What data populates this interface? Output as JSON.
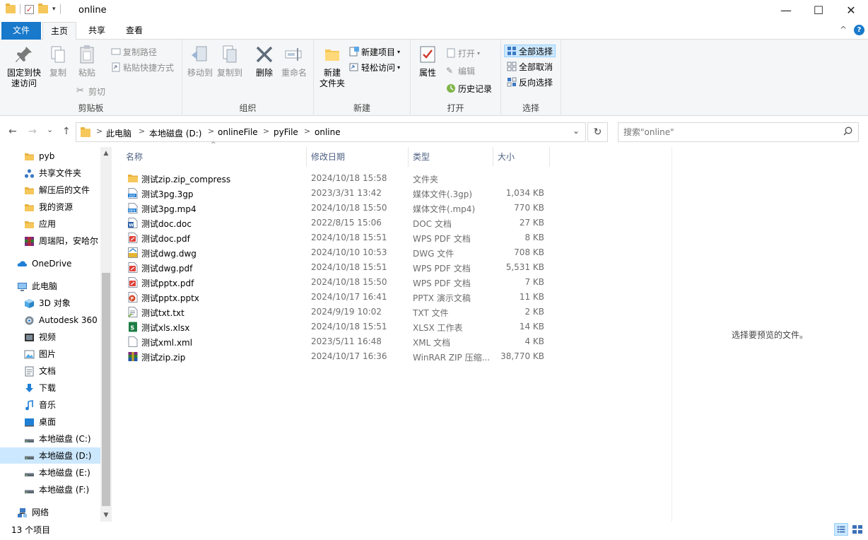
{
  "window": {
    "title": "online",
    "minimize_glyph": "—",
    "maximize_glyph": "☐",
    "close_glyph": "✕"
  },
  "ribbon_tabs": {
    "file": "文件",
    "home": "主页",
    "share": "共享",
    "view": "查看",
    "collapse_glyph": "^",
    "help_glyph": "?"
  },
  "ribbon": {
    "clipboard": {
      "label": "剪贴板",
      "pin": "固定到快\n速访问",
      "copy": "复制",
      "paste": "粘贴",
      "copy_path": "复制路径",
      "paste_shortcut": "粘贴快捷方式",
      "cut": "剪切"
    },
    "organize": {
      "label": "组织",
      "move_to": "移动到",
      "copy_to": "复制到",
      "delete": "删除",
      "rename": "重命名"
    },
    "new": {
      "label": "新建",
      "new_folder": "新建\n文件夹",
      "new_item": "新建项目",
      "easy_access": "轻松访问"
    },
    "open": {
      "label": "打开",
      "properties": "属性",
      "open": "打开",
      "edit": "编辑",
      "history": "历史记录"
    },
    "select": {
      "label": "选择",
      "select_all": "全部选择",
      "select_none": "全部取消",
      "invert": "反向选择"
    }
  },
  "address": {
    "crumbs": [
      "此电脑",
      "本地磁盘 (D:)",
      "onlineFile",
      "pyFile",
      "online"
    ],
    "separator": ">",
    "dropdown_glyph": "⌄",
    "refresh_glyph": "↻"
  },
  "search": {
    "placeholder": "搜索\"online\"",
    "icon": "search-icon"
  },
  "nav": {
    "back_glyph": "←",
    "forward_glyph": "→",
    "recent_glyph": "⌄",
    "up_glyph": "↑",
    "items": [
      {
        "label": "pyb",
        "icon": "folder-icon"
      },
      {
        "label": "共享文件夹",
        "icon": "share-icon"
      },
      {
        "label": "解压后的文件",
        "icon": "folder-icon"
      },
      {
        "label": "我的资源",
        "icon": "folder-icon"
      },
      {
        "label": "应用",
        "icon": "folder-icon"
      },
      {
        "label": "周瑞阳，安哈尔",
        "icon": "rar-icon"
      },
      {
        "label": "OneDrive",
        "icon": "cloud-icon"
      },
      {
        "label": "此电脑",
        "icon": "computer-icon"
      },
      {
        "label": "3D 对象",
        "icon": "cube-icon"
      },
      {
        "label": "Autodesk 360",
        "icon": "autodesk-icon"
      },
      {
        "label": "视频",
        "icon": "video-icon"
      },
      {
        "label": "图片",
        "icon": "picture-icon"
      },
      {
        "label": "文档",
        "icon": "document-icon"
      },
      {
        "label": "下载",
        "icon": "download-icon"
      },
      {
        "label": "音乐",
        "icon": "music-icon"
      },
      {
        "label": "桌面",
        "icon": "desktop-icon"
      },
      {
        "label": "本地磁盘 (C:)",
        "icon": "drive-icon"
      },
      {
        "label": "本地磁盘 (D:)",
        "icon": "drive-icon",
        "selected": true
      },
      {
        "label": "本地磁盘 (E:)",
        "icon": "drive-icon"
      },
      {
        "label": "本地磁盘 (F:)",
        "icon": "drive-icon"
      },
      {
        "label": "网络",
        "icon": "network-icon"
      }
    ]
  },
  "columns": {
    "name": "名称",
    "modified": "修改日期",
    "type": "类型",
    "size": "大小"
  },
  "files": [
    {
      "name": "测试zip.zip_compress",
      "modified": "2024/10/18 15:58",
      "type": "文件夹",
      "size": "",
      "icon": "folder-icon"
    },
    {
      "name": "测试3pg.3gp",
      "modified": "2023/3/31 13:42",
      "type": "媒体文件(.3gp)",
      "size": "1,034 KB",
      "icon": "3gp-icon"
    },
    {
      "name": "测试3pg.mp4",
      "modified": "2024/10/18 15:50",
      "type": "媒体文件(.mp4)",
      "size": "770 KB",
      "icon": "mp4-icon"
    },
    {
      "name": "测试doc.doc",
      "modified": "2022/8/15 15:06",
      "type": "DOC 文档",
      "size": "27 KB",
      "icon": "doc-icon"
    },
    {
      "name": "测试doc.pdf",
      "modified": "2024/10/18 15:51",
      "type": "WPS PDF 文档",
      "size": "8 KB",
      "icon": "pdf-icon"
    },
    {
      "name": "测试dwg.dwg",
      "modified": "2024/10/10 10:53",
      "type": "DWG 文件",
      "size": "708 KB",
      "icon": "dwg-icon"
    },
    {
      "name": "测试dwg.pdf",
      "modified": "2024/10/18 15:51",
      "type": "WPS PDF 文档",
      "size": "5,531 KB",
      "icon": "pdf-icon"
    },
    {
      "name": "测试pptx.pdf",
      "modified": "2024/10/18 15:50",
      "type": "WPS PDF 文档",
      "size": "7 KB",
      "icon": "pdf-icon"
    },
    {
      "name": "测试pptx.pptx",
      "modified": "2024/10/17 16:41",
      "type": "PPTX 演示文稿",
      "size": "11 KB",
      "icon": "pptx-icon"
    },
    {
      "name": "测试txt.txt",
      "modified": "2024/9/19 10:02",
      "type": "TXT 文件",
      "size": "2 KB",
      "icon": "txt-icon"
    },
    {
      "name": "测试xls.xlsx",
      "modified": "2024/10/18 15:51",
      "type": "XLSX 工作表",
      "size": "14 KB",
      "icon": "xlsx-icon"
    },
    {
      "name": "测试xml.xml",
      "modified": "2023/5/11 16:48",
      "type": "XML 文档",
      "size": "4 KB",
      "icon": "xml-icon"
    },
    {
      "name": "测试zip.zip",
      "modified": "2024/10/17 16:36",
      "type": "WinRAR ZIP 压缩...",
      "size": "38,770 KB",
      "icon": "zip-icon"
    }
  ],
  "preview": {
    "placeholder": "选择要预览的文件。"
  },
  "status": {
    "count": "13 个项目"
  },
  "colors": {
    "accent": "#1979ca",
    "selection": "#cce8ff",
    "folder": "#f6c75a",
    "ribbon_bg": "#f5f6f7"
  }
}
